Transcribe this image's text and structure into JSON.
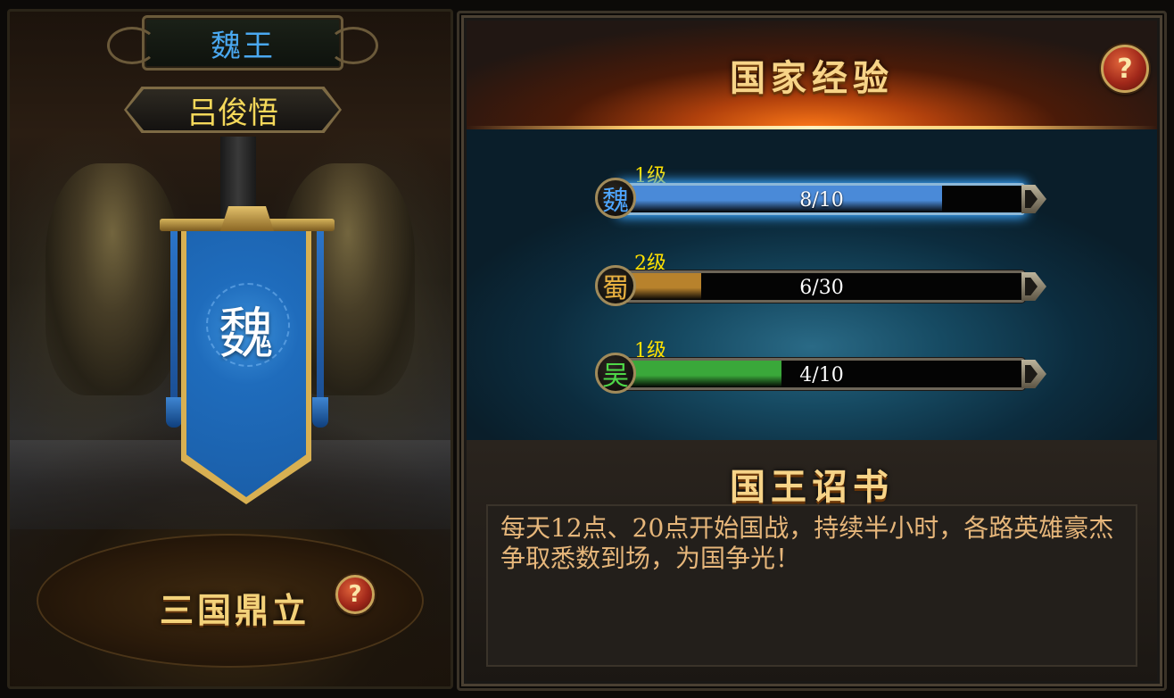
{
  "left": {
    "title": "魏王",
    "player_name": "吕俊悟",
    "banner_kingdom": "魏",
    "bottom_title": "三国鼎立",
    "help_label": "?"
  },
  "national_exp": {
    "title": "国家经验",
    "help_label": "?",
    "kingdoms": [
      {
        "badge": "魏",
        "badge_color": "#4ea6ff",
        "level": "1级",
        "value": "8/10",
        "fill_fraction": 0.8,
        "fill_color": "#4a8ad8",
        "active": true
      },
      {
        "badge": "蜀",
        "badge_color": "#e8b040",
        "level": "2级",
        "value": "6/30",
        "fill_fraction": 0.2,
        "fill_color": "#b8822c",
        "active": false
      },
      {
        "badge": "吴",
        "badge_color": "#4ed848",
        "level": "1级",
        "value": "4/10",
        "fill_fraction": 0.4,
        "fill_color": "#3aa83a",
        "active": false
      }
    ]
  },
  "edict": {
    "title": "国王诏书",
    "text": "每天12点、20点开始国战，持续半小时，各路英雄豪杰争取悉数到场，为国争光！"
  }
}
